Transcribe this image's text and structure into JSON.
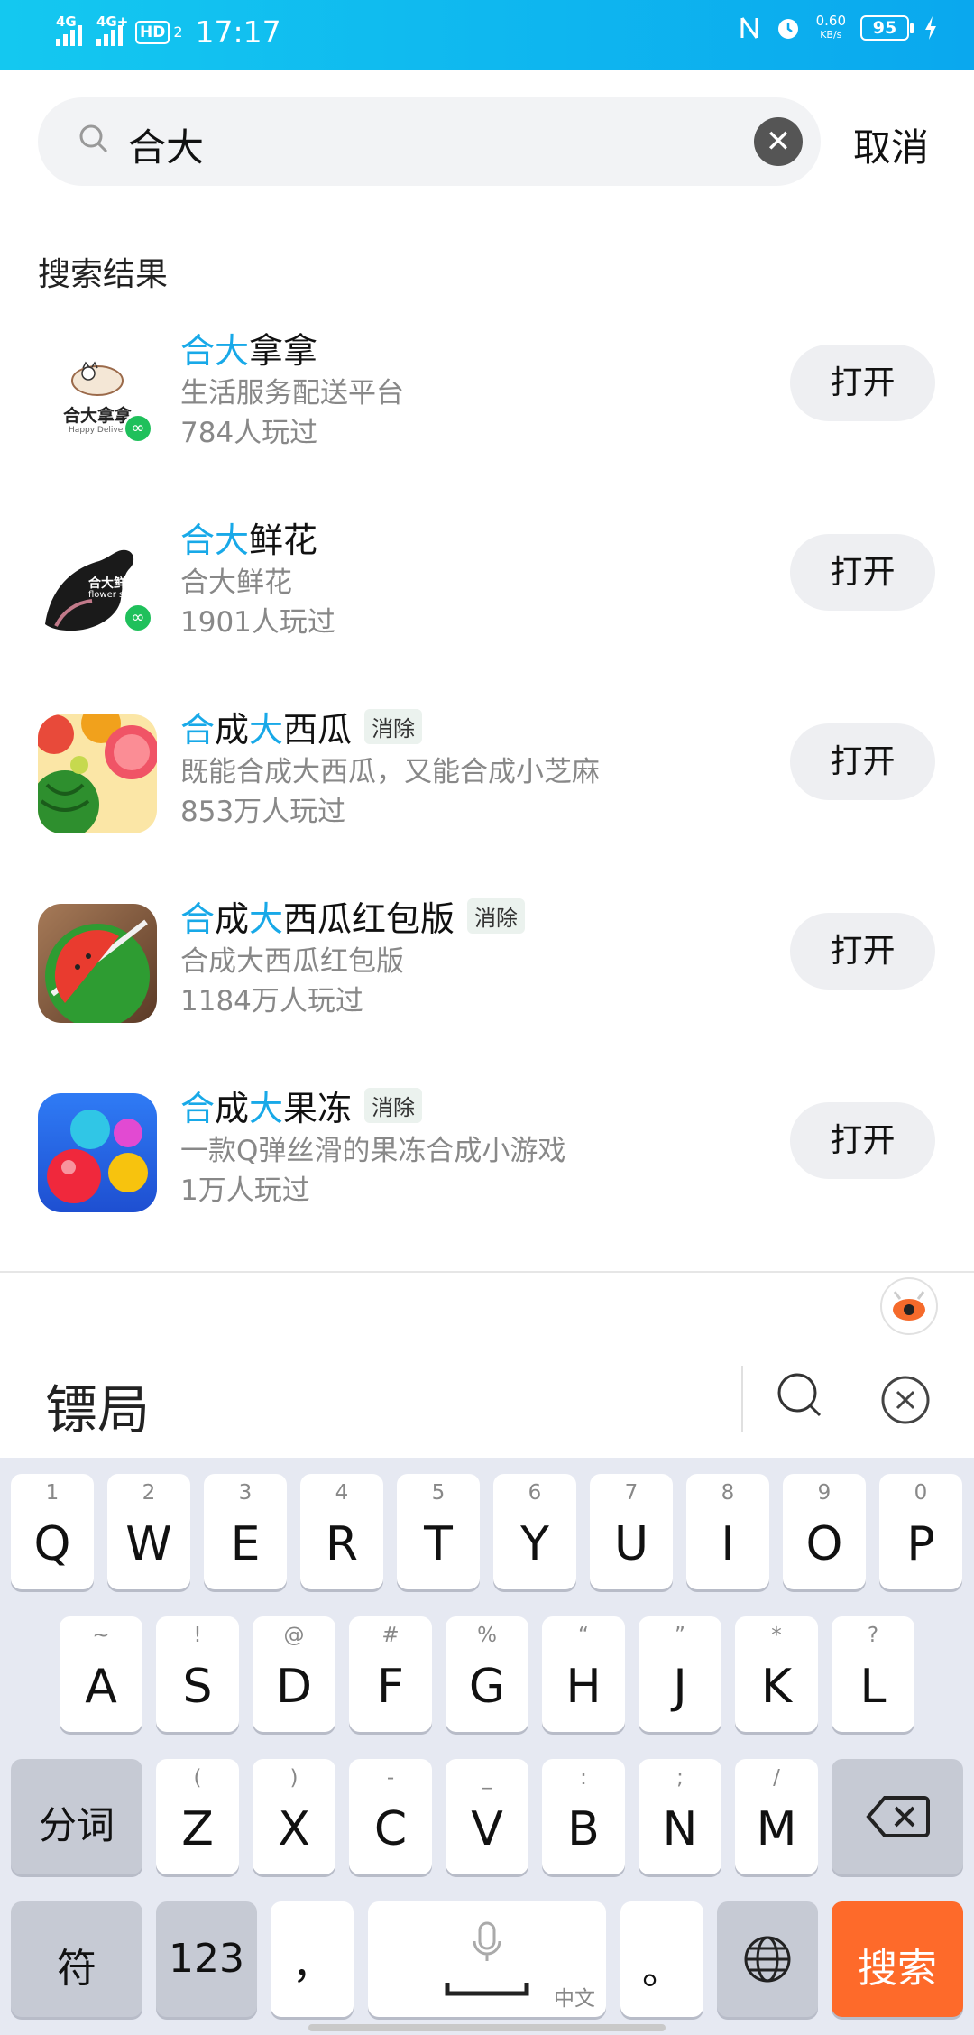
{
  "status_bar": {
    "time": "17:17",
    "net1": "4G",
    "net2": "4G+",
    "hd": "HD",
    "hd_sub": "2",
    "speed_value": "0.60",
    "speed_unit": "KB/s",
    "battery": "95"
  },
  "search": {
    "query": "合大",
    "cancel": "取消"
  },
  "results": {
    "title": "搜索结果",
    "open_label": "打开",
    "items": [
      {
        "name_parts": [
          {
            "t": "合大",
            "hl": true
          },
          {
            "t": "拿拿",
            "hl": false
          }
        ],
        "desc": "生活服务配送平台",
        "plays": "784人玩过",
        "tag": "",
        "icon": "hedanana-logo-icon"
      },
      {
        "name_parts": [
          {
            "t": "合大",
            "hl": true
          },
          {
            "t": "鲜花",
            "hl": false
          }
        ],
        "desc": "合大鲜花",
        "plays": "1901人玩过",
        "tag": "",
        "icon": "flower-store-logo-icon"
      },
      {
        "name_parts": [
          {
            "t": "合",
            "hl": true
          },
          {
            "t": "成",
            "hl": false
          },
          {
            "t": "大",
            "hl": true
          },
          {
            "t": "西瓜",
            "hl": false
          }
        ],
        "desc": "既能合成大西瓜，又能合成小芝麻",
        "plays": "853万人玩过",
        "tag": "消除",
        "icon": "fruit-game-icon"
      },
      {
        "name_parts": [
          {
            "t": "合",
            "hl": true
          },
          {
            "t": "成",
            "hl": false
          },
          {
            "t": "大",
            "hl": true
          },
          {
            "t": "西瓜红包版",
            "hl": false
          }
        ],
        "desc": "合成大西瓜红包版",
        "plays": "1184万人玩过",
        "tag": "消除",
        "icon": "sliced-watermelon-icon"
      },
      {
        "name_parts": [
          {
            "t": "合",
            "hl": true
          },
          {
            "t": "成",
            "hl": false
          },
          {
            "t": "大",
            "hl": true
          },
          {
            "t": "果冻",
            "hl": false
          }
        ],
        "desc": "一款Q弹丝滑的果冻合成小游戏",
        "plays": "1万人玩过",
        "tag": "消除",
        "icon": "jelly-bubbles-icon"
      }
    ]
  },
  "logos": {
    "hedanana_text": "合大拿拿",
    "hedanana_sub": "Happy Deliver",
    "flower_text": "合大鲜花",
    "flower_sub": "flower store"
  },
  "candidate": {
    "text": "镖局"
  },
  "keyboard": {
    "row1": [
      {
        "k": "Q",
        "s": "1"
      },
      {
        "k": "W",
        "s": "2"
      },
      {
        "k": "E",
        "s": "3"
      },
      {
        "k": "R",
        "s": "4"
      },
      {
        "k": "T",
        "s": "5"
      },
      {
        "k": "Y",
        "s": "6"
      },
      {
        "k": "U",
        "s": "7"
      },
      {
        "k": "I",
        "s": "8"
      },
      {
        "k": "O",
        "s": "9"
      },
      {
        "k": "P",
        "s": "0"
      }
    ],
    "row2": [
      {
        "k": "A",
        "s": "~"
      },
      {
        "k": "S",
        "s": "!"
      },
      {
        "k": "D",
        "s": "@"
      },
      {
        "k": "F",
        "s": "#"
      },
      {
        "k": "G",
        "s": "%"
      },
      {
        "k": "H",
        "s": "“"
      },
      {
        "k": "J",
        "s": "”"
      },
      {
        "k": "K",
        "s": "*"
      },
      {
        "k": "L",
        "s": "?"
      }
    ],
    "row3_left": "分词",
    "row3": [
      {
        "k": "Z",
        "s": "("
      },
      {
        "k": "X",
        "s": ")"
      },
      {
        "k": "C",
        "s": "-"
      },
      {
        "k": "V",
        "s": "_"
      },
      {
        "k": "B",
        "s": ":"
      },
      {
        "k": "N",
        "s": ";"
      },
      {
        "k": "M",
        "s": "/"
      }
    ],
    "row4": {
      "sym": "符",
      "num": "123",
      "comma": "，",
      "space_sub": "中文",
      "period": "。",
      "search": "搜索"
    }
  }
}
